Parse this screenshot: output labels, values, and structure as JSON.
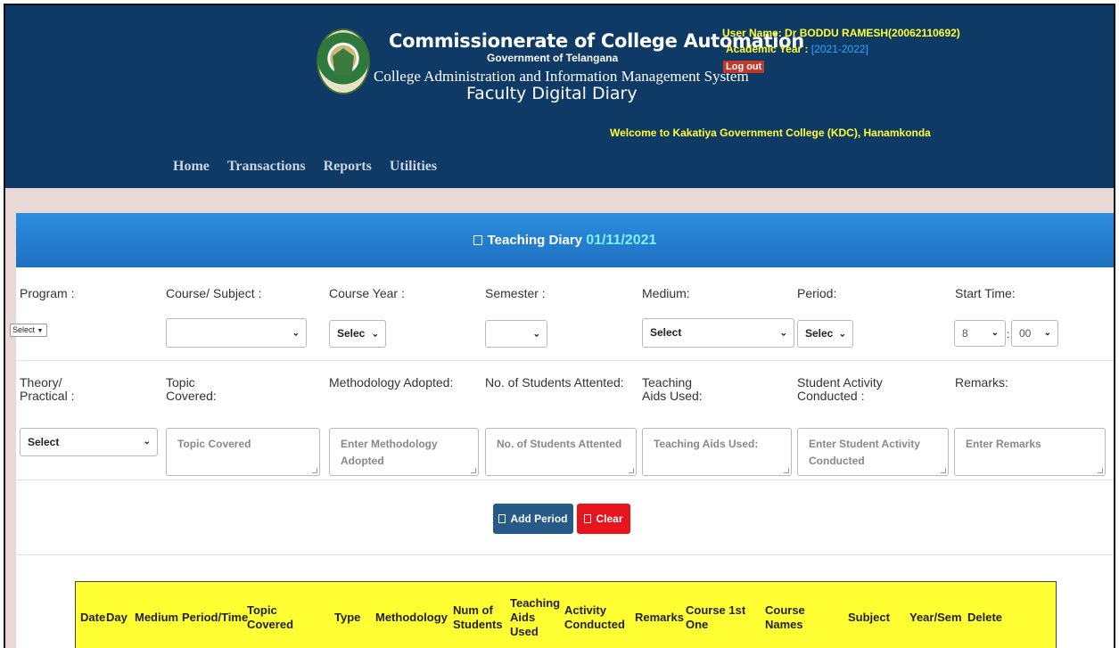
{
  "header": {
    "title": "Commissionerate of College Automation",
    "government": "Government of Telangana",
    "system_name": "College Administration and Information Management System",
    "module": "Faculty Digital Diary",
    "user_label": "User Name:",
    "user_name": "Dr BODDU RAMESH(20062110692)",
    "academic_year_label": "Academic Year :",
    "academic_year": "[2021-2022]",
    "logout_label": "Log out",
    "welcome": "Welcome to  Kakatiya Government College (KDC), Hanamkonda"
  },
  "nav": {
    "home": "Home",
    "transactions": "Transactions",
    "reports": "Reports",
    "utilities": "Utilities"
  },
  "panel": {
    "title": "Teaching Diary",
    "date": "01/11/2021"
  },
  "form": {
    "program_label": "Program :",
    "course_subject_label": "Course/ Subject :",
    "course_year_label": "Course Year :",
    "semester_label": "Semester :",
    "medium_label": "Medium:",
    "period_label": "Period:",
    "start_time_label": "Start Time:",
    "program_value": "Select",
    "course_subject_value": "",
    "course_year_value": "Selec",
    "semester_value": "",
    "medium_value": "Select",
    "period_value": "Selec",
    "start_hour": "8",
    "start_minute": "00",
    "time_separator": ":",
    "theory_label_1": "Theory/",
    "theory_label_2": "Practical :",
    "topic_label_1": "Topic",
    "topic_label_2": "Covered:",
    "methodology_label": "Methodology Adopted:",
    "students_label": "No. of Students Attented:",
    "aids_label_1": "Teaching",
    "aids_label_2": "Aids Used:",
    "activity_label_1": "Student Activity",
    "activity_label_2": "Conducted :",
    "remarks_label": "Remarks:",
    "theory_value": "Select",
    "topic_placeholder": "Topic Covered",
    "methodology_placeholder": "Enter Methodology Adopted",
    "students_placeholder": "No. of Students Attented",
    "aids_placeholder": "Teaching Aids Used:",
    "activity_placeholder_1": "Enter Student Activity",
    "activity_placeholder_2": "Conducted",
    "remarks_placeholder": "Enter Remarks"
  },
  "buttons": {
    "add_period": "Add Period",
    "clear": "Clear"
  },
  "table": {
    "date": "Date",
    "day": "Day",
    "medium": "Medium",
    "period_time": "Period/Time",
    "topic_1": "Topic",
    "topic_2": "Covered",
    "type": "Type",
    "methodology": "Methodology",
    "num_1": "Num of",
    "num_2": "Students",
    "aids_1": "Teaching",
    "aids_2": "Aids",
    "aids_3": "Used",
    "activity_1": "Activity",
    "activity_2": "Conducted",
    "remarks": "Remarks",
    "course1_1": "Course 1st",
    "course1_2": "One",
    "names_1": "Course",
    "names_2": "Names",
    "subject": "Subject",
    "year_sem": "Year/Sem",
    "delete": "Delete"
  },
  "colors": {
    "header_bg": "#0f3a66",
    "accent_yellow": "#ffff33",
    "panel_head": "#1e6fc0",
    "add_button": "#265a88",
    "clear_button": "#e8141b"
  }
}
